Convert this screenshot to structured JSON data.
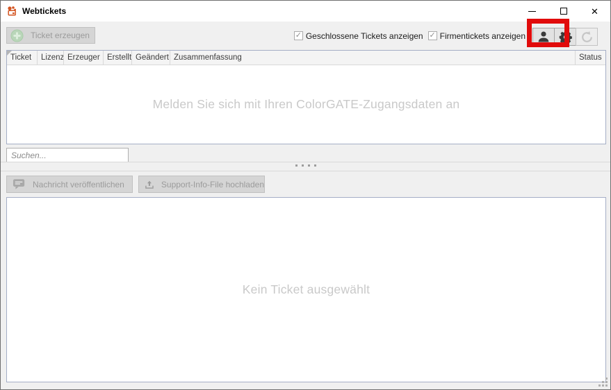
{
  "window": {
    "title": "Webtickets",
    "controls": {
      "close_glyph": "✕"
    }
  },
  "toolbar": {
    "create_ticket_label": "Ticket erzeugen",
    "check_glyph": "✓",
    "show_closed_label": "Geschlossene Tickets anzeigen",
    "show_company_label": "Firmentickets anzeigen",
    "icons": [
      "user-icon",
      "gear-icon",
      "refresh-icon"
    ]
  },
  "table": {
    "columns": [
      "Ticket",
      "Lizenz",
      "Erzeuger",
      "Erstellt",
      "Geändert",
      "Zusammenfassung",
      "Status"
    ],
    "empty_message": "Melden Sie sich mit Ihren ColorGATE-Zugangsdaten an"
  },
  "search": {
    "placeholder": "Suchen..."
  },
  "detail_toolbar": {
    "publish_label": "Nachricht veröffentlichen",
    "upload_label": "Support-Info-File hochladen"
  },
  "detail": {
    "empty_message": "Kein Ticket ausgewählt"
  },
  "annotation": {
    "highlight_color": "#e10b0b",
    "highlighted_element": "user-icon-button"
  },
  "colors": {
    "accent_green_disabled": "#b9d6b9",
    "panel_border": "#a5aec6",
    "annotation_red": "#e10b0b",
    "app_icon_orange": "#d35421"
  }
}
